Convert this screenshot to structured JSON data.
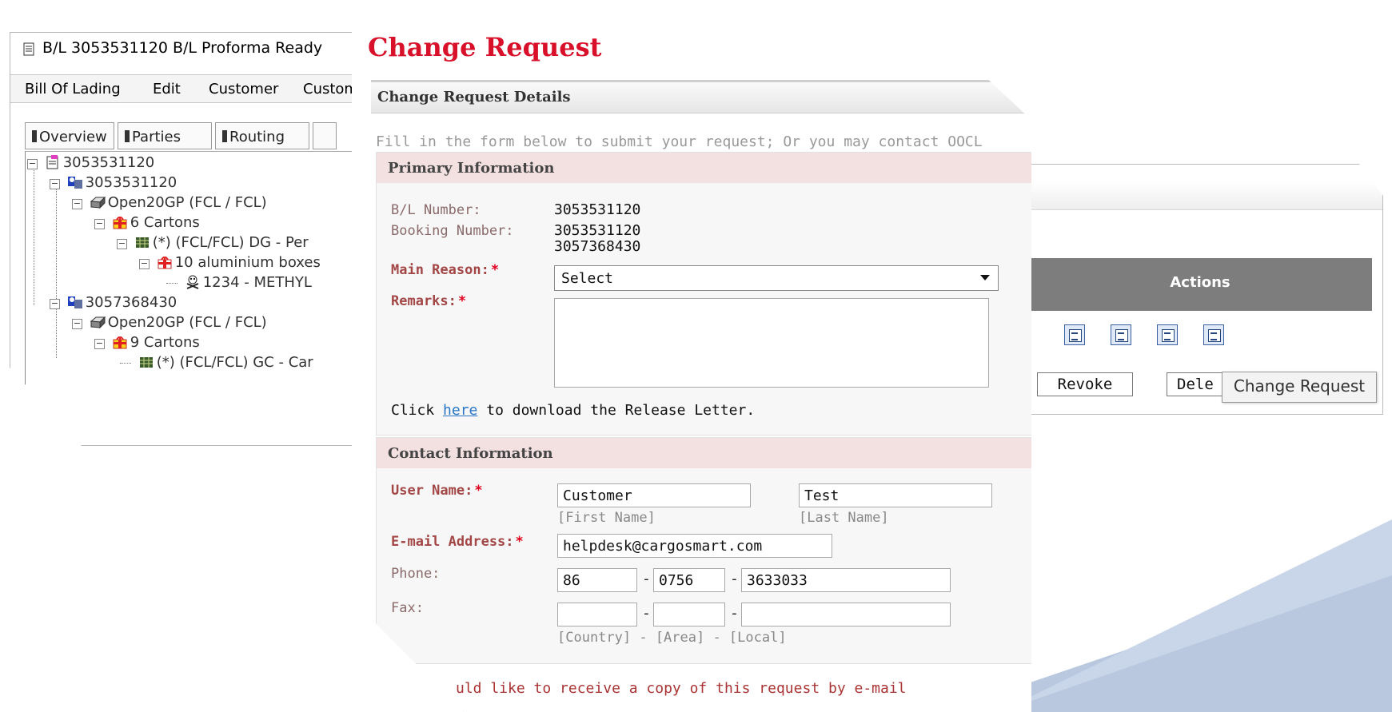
{
  "bl_window": {
    "title": "B/L 3053531120 B/L Proforma Ready",
    "menu": [
      "Bill Of Lading",
      "Edit",
      "Customer",
      "Custom"
    ],
    "tabs": [
      "Overview",
      "Parties",
      "Routing"
    ],
    "tree": [
      {
        "text": "3053531120",
        "icon": "document-icon"
      },
      {
        "text": "3053531120",
        "icon": "booking-icon"
      },
      {
        "text": "Open20GP (FCL / FCL)",
        "icon": "container-icon"
      },
      {
        "text": "6 Cartons",
        "icon": "package-icon"
      },
      {
        "text": "(*) (FCL/FCL) DG - Per",
        "icon": "cargo-icon"
      },
      {
        "text": "10 aluminium boxes",
        "icon": "package-icon"
      },
      {
        "text": "1234 - METHYL",
        "icon": "hazard-icon"
      },
      {
        "text": "3057368430",
        "icon": "booking-icon"
      },
      {
        "text": "Open20GP (FCL / FCL)",
        "icon": "container-icon"
      },
      {
        "text": "9 Cartons",
        "icon": "package-icon"
      },
      {
        "text": "(*) (FCL/FCL) GC - Car",
        "icon": "cargo-icon"
      }
    ]
  },
  "form": {
    "title": "Change Request",
    "details_heading": "Change Request Details",
    "intro": "Fill in the form below to submit your request; Or you may contact OOCL",
    "primary": {
      "heading": "Primary Information",
      "bl_number_label": "B/L Number:",
      "bl_number": "3053531120",
      "booking_number_label": "Booking Number:",
      "booking_numbers": [
        "3053531120",
        "3057368430"
      ],
      "main_reason_label": "Main Reason:",
      "main_reason_value": "Select",
      "remarks_label": "Remarks:",
      "release_prefix": "Click",
      "release_link": "here",
      "release_suffix": "to download the Release Letter."
    },
    "contact": {
      "heading": "Contact Information",
      "user_name_label": "User Name:",
      "first_name": "Customer",
      "last_name": "Test",
      "first_name_hint": "[First Name]",
      "last_name_hint": "[Last Name]",
      "email_label": "E-mail Address:",
      "email": "helpdesk@cargosmart.com",
      "phone_label": "Phone:",
      "phone_country": "86",
      "phone_area": "0756",
      "phone_local": "3633033",
      "fax_label": "Fax:",
      "fax_country": "",
      "fax_area": "",
      "fax_local": "",
      "phone_hint": "[Country] - [Area] - [Local]"
    },
    "copy_text": "uld like to receive a copy of this request by e-mail"
  },
  "actions_window": {
    "header": "Actions",
    "icons": [
      "view-icon",
      "edit-icon",
      "print-icon",
      "change-request-icon"
    ],
    "revoke_label": "Revoke",
    "delete_label": "Dele",
    "tooltip": "Change Request"
  },
  "colors": {
    "title_red": "#d8102a",
    "section_pink": "#f3e0e0",
    "actions_header_gray": "#7d7d7d",
    "link_blue": "#2a76c6",
    "wedge_blue": "#b9c8df"
  }
}
